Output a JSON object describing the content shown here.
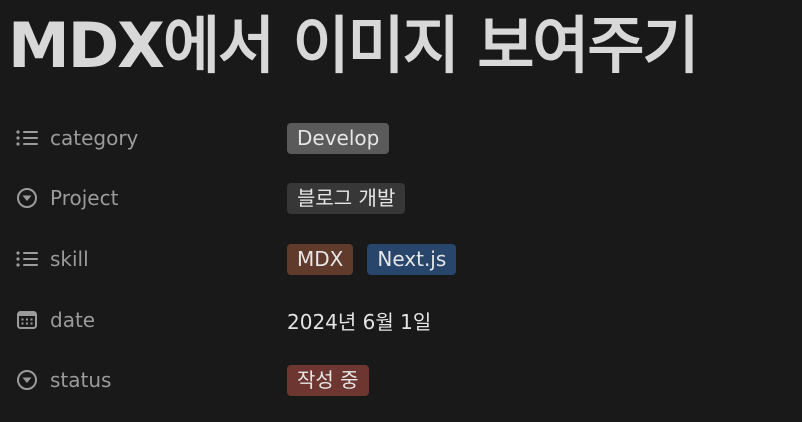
{
  "page": {
    "title": "MDX에서 이미지 보여주기"
  },
  "properties": [
    {
      "label": "category",
      "icon": "list-icon"
    },
    {
      "label": "Project",
      "icon": "select-circle-icon"
    },
    {
      "label": "skill",
      "icon": "list-icon"
    },
    {
      "label": "date",
      "icon": "calendar-icon"
    },
    {
      "label": "status",
      "icon": "select-circle-icon"
    }
  ],
  "values": {
    "category": {
      "text": "Develop",
      "color": "#5a5a5a"
    },
    "project": {
      "text": "블로그 개발",
      "color": "#373737"
    },
    "skill": [
      {
        "text": "MDX",
        "color": "#603b2c"
      },
      {
        "text": "Next.js",
        "color": "#28456c"
      }
    ],
    "date": "2024년 6월 1일",
    "status": {
      "text": "작성 중",
      "color": "#6e3630"
    }
  },
  "theme": {
    "background": "#191919",
    "label_color": "#9b9b9b",
    "text_color": "#d8d8d8"
  }
}
